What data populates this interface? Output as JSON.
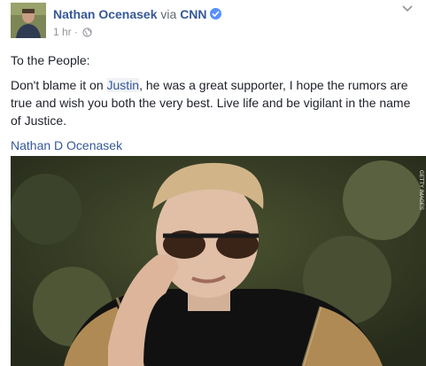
{
  "post": {
    "author": "Nathan Ocenasek",
    "via": "via",
    "page": "CNN",
    "time": "1 hr",
    "separator": "·",
    "body": {
      "greeting": "To the People:",
      "text_before_mention": "Don't blame it on ",
      "mention": "Justin",
      "text_after_mention": ", he was a great supporter, I hope the rumors are true and wish you both the very best. Live life and be vigilant in the name of Justice.",
      "signature": "Nathan D Ocenasek"
    },
    "image": {
      "credit": "GETTY IMAGES"
    }
  },
  "icons": {
    "verified": "verified-badge-icon",
    "globe": "globe-icon",
    "menu": "chevron-down-icon"
  },
  "colors": {
    "link": "#365899",
    "meta": "#90949c",
    "text": "#1d2129",
    "verified": "#5890ff"
  }
}
